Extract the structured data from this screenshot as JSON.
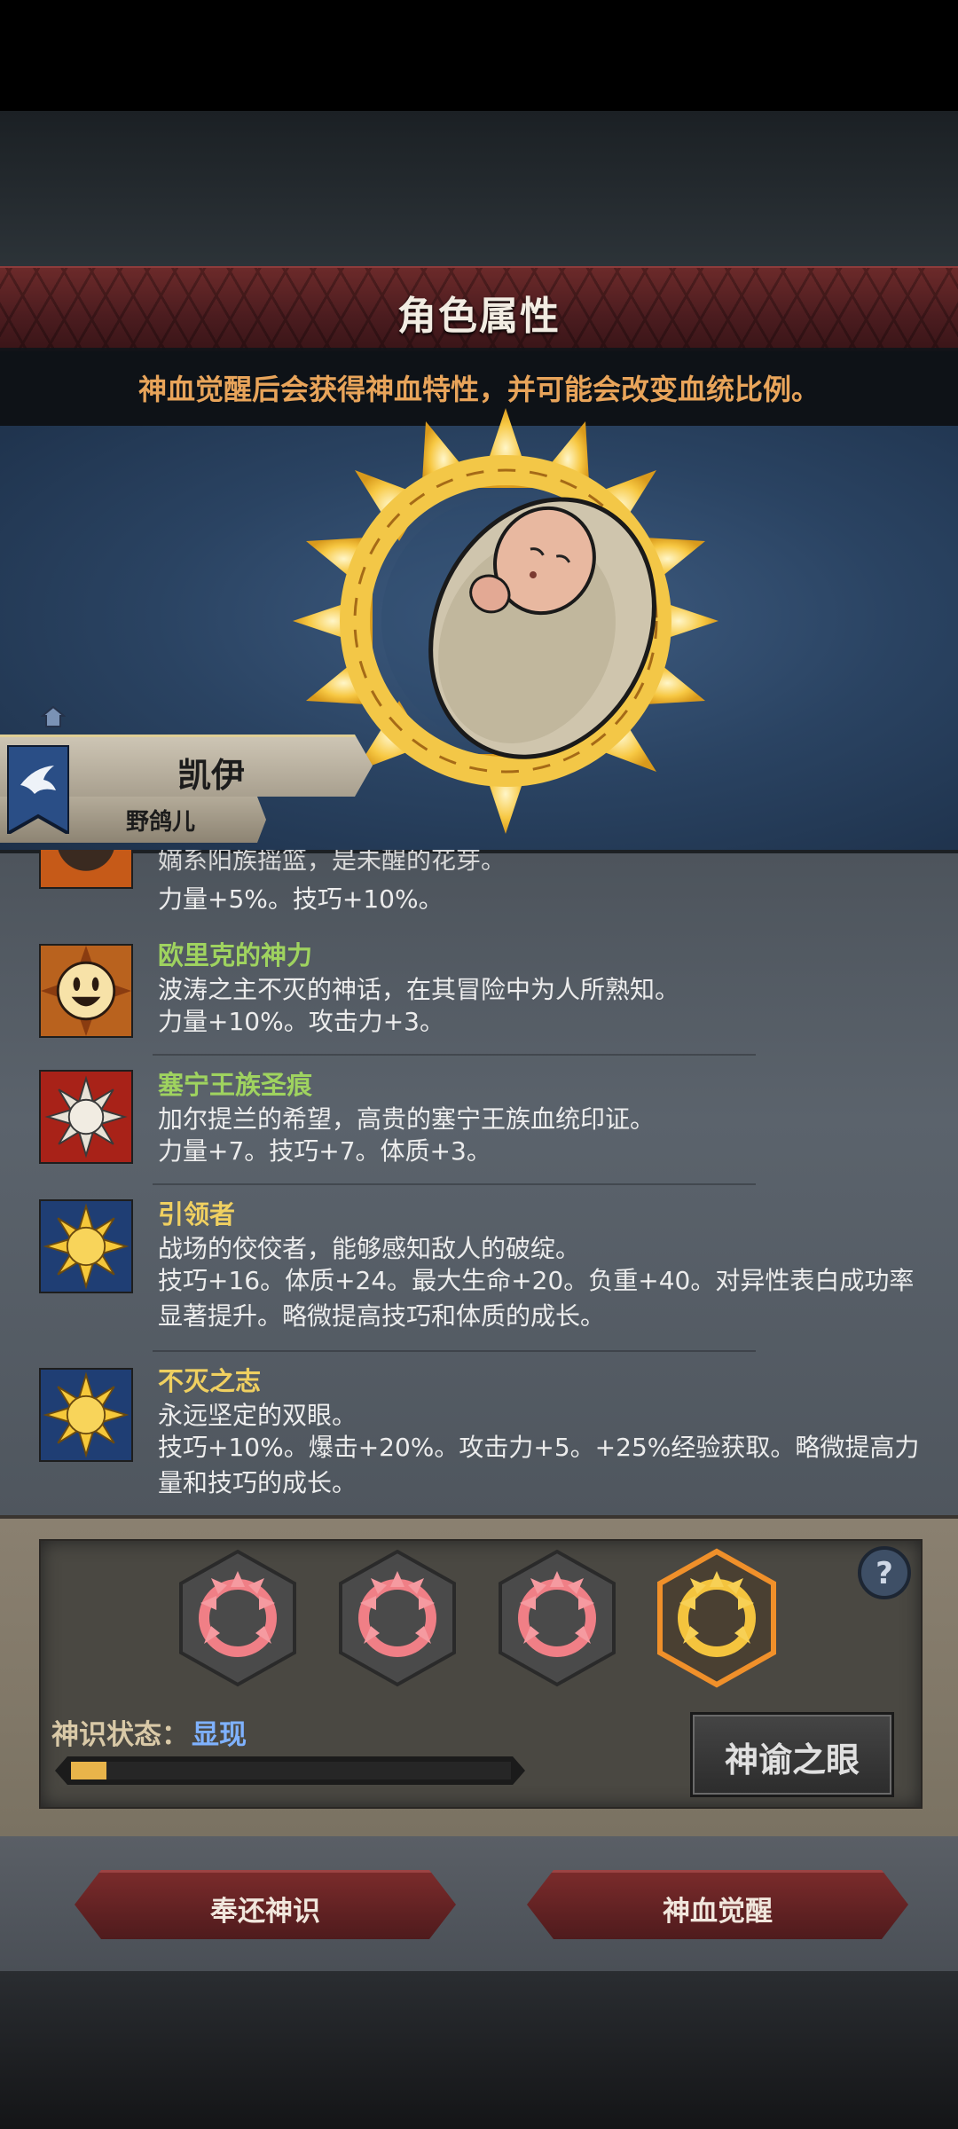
{
  "header": {
    "title": "角色属性",
    "notice": "神血觉醒后会获得神血特性，并可能会改变血统比例。"
  },
  "character": {
    "name": "凯伊",
    "title": "野鸽儿"
  },
  "traits": [
    {
      "name": "",
      "desc": "嫡系阳族摇篮，是未醒的花芽。",
      "stats": "力量+5%。技巧+10%。",
      "name_color": "#9fd35f",
      "icon": "sun-face-icon"
    },
    {
      "name": "欧里克的神力",
      "desc": "波涛之主不灭的神话，在其冒险中为人所熟知。",
      "stats": "力量+10%。攻击力+3。",
      "name_color": "#9fd35f",
      "icon": "smiling-sun-icon"
    },
    {
      "name": "塞宁王族圣痕",
      "desc": "加尔提兰的希望，高贵的塞宁王族血统印证。",
      "stats": "力量+7。技巧+7。体质+3。",
      "name_color": "#9fd35f",
      "icon": "white-sun-icon"
    },
    {
      "name": "引领者",
      "desc": "战场的佼佼者，能够感知敌人的破绽。",
      "stats": "技巧+16。体质+24。最大生命+20。负重+40。对异性表白成功率显著提升。略微提高技巧和体质的成长。",
      "name_color": "#f0d060",
      "icon": "golden-sun-icon"
    },
    {
      "name": "不灭之志",
      "desc": "永远坚定的双眼。",
      "stats": "技巧+10%。爆击+20%。攻击力+5。+25%经验获取。略微提高力量和技巧的成长。",
      "name_color": "#f0d060",
      "icon": "golden-sun-icon"
    }
  ],
  "panel": {
    "state_label": "神识状态：",
    "state_value": "显现",
    "progress": 0.08,
    "oracle_button": "神谕之眼",
    "help_icon": "question-icon"
  },
  "footer": {
    "return_button": "奉还神识",
    "awaken_button": "神血觉醒"
  },
  "colors": {
    "green_name": "#9fd35f",
    "gold_name": "#f0d060",
    "progress_fill": "#e9b44a"
  }
}
